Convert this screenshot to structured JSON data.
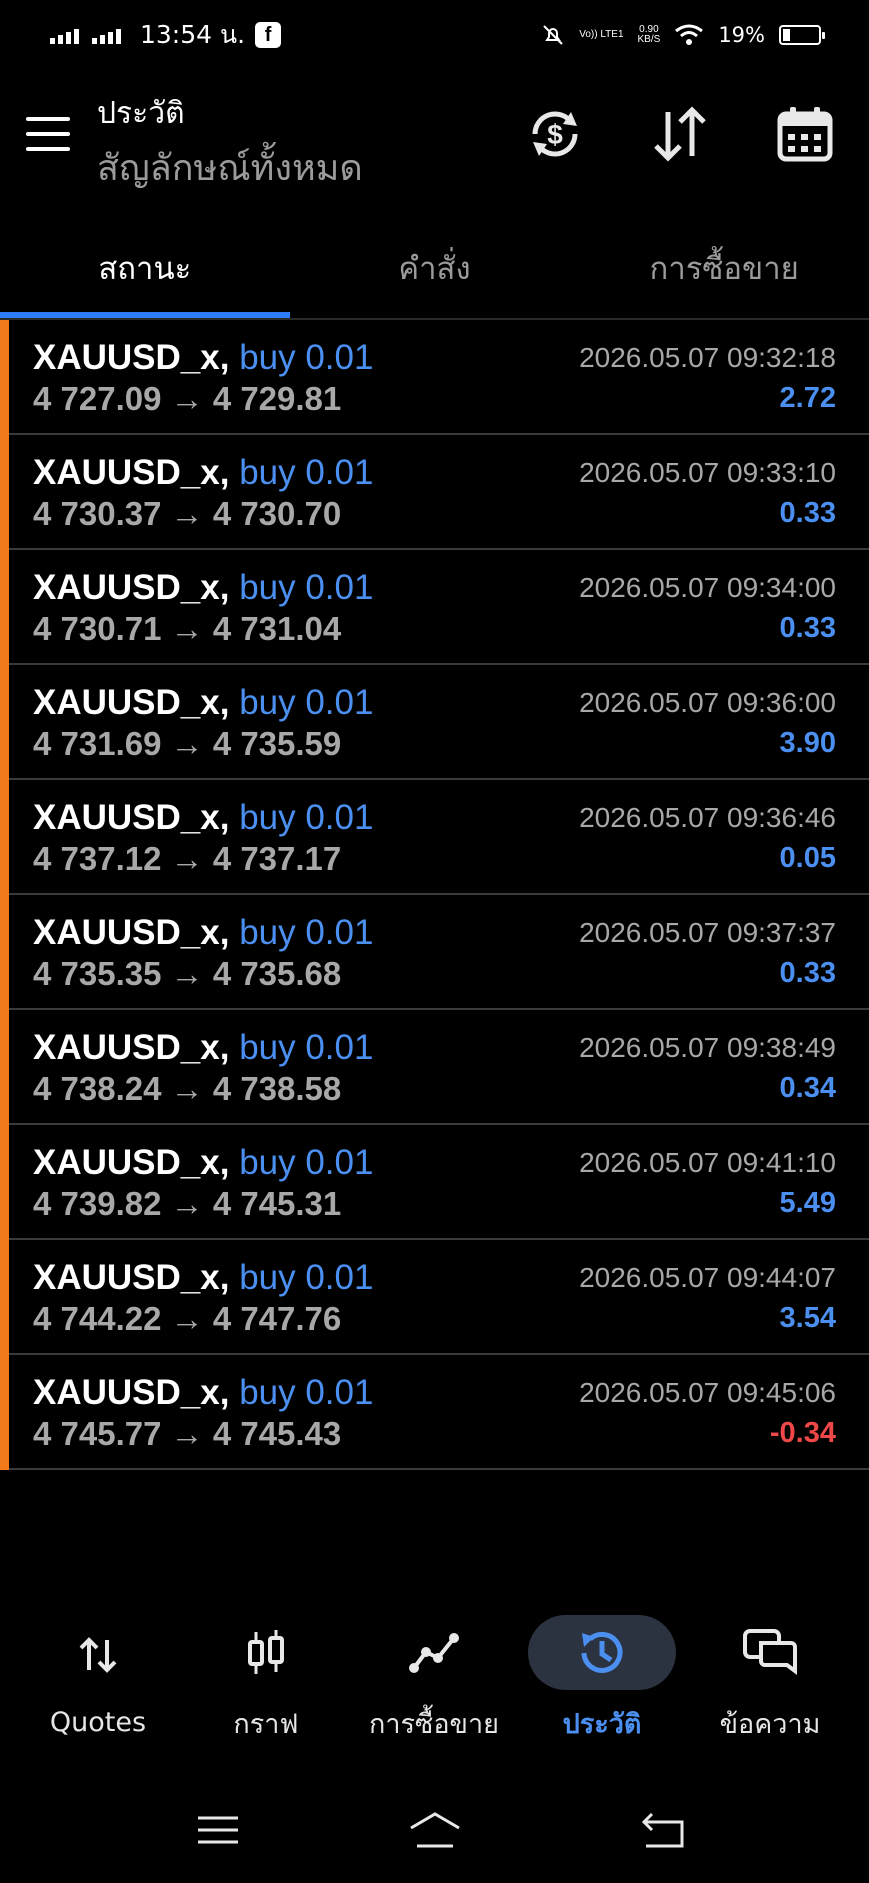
{
  "status_bar": {
    "time": "13:54 น.",
    "app_badge": "f",
    "volte": "Vo)) LTE1",
    "speed_value": "0.90",
    "speed_unit": "KB/S",
    "battery_percent": "19%",
    "battery_level": 0.19
  },
  "header": {
    "title": "ประวัติ",
    "subtitle": "สัญลักษณ์ทั้งหมด"
  },
  "tabs": [
    {
      "label": "สถานะ",
      "active": true
    },
    {
      "label": "คำสั่ง",
      "active": false
    },
    {
      "label": "การซื้อขาย",
      "active": false
    }
  ],
  "arrow": "→",
  "trades": [
    {
      "symbol": "XAUUSD_x,",
      "type": "buy 0.01",
      "open": "4 727.09",
      "close": "4 729.81",
      "time": "2026.05.07 09:32:18",
      "profit": "2.72"
    },
    {
      "symbol": "XAUUSD_x,",
      "type": "buy 0.01",
      "open": "4 730.37",
      "close": "4 730.70",
      "time": "2026.05.07 09:33:10",
      "profit": "0.33"
    },
    {
      "symbol": "XAUUSD_x,",
      "type": "buy 0.01",
      "open": "4 730.71",
      "close": "4 731.04",
      "time": "2026.05.07 09:34:00",
      "profit": "0.33"
    },
    {
      "symbol": "XAUUSD_x,",
      "type": "buy 0.01",
      "open": "4 731.69",
      "close": "4 735.59",
      "time": "2026.05.07 09:36:00",
      "profit": "3.90"
    },
    {
      "symbol": "XAUUSD_x,",
      "type": "buy 0.01",
      "open": "4 737.12",
      "close": "4 737.17",
      "time": "2026.05.07 09:36:46",
      "profit": "0.05"
    },
    {
      "symbol": "XAUUSD_x,",
      "type": "buy 0.01",
      "open": "4 735.35",
      "close": "4 735.68",
      "time": "2026.05.07 09:37:37",
      "profit": "0.33"
    },
    {
      "symbol": "XAUUSD_x,",
      "type": "buy 0.01",
      "open": "4 738.24",
      "close": "4 738.58",
      "time": "2026.05.07 09:38:49",
      "profit": "0.34"
    },
    {
      "symbol": "XAUUSD_x,",
      "type": "buy 0.01",
      "open": "4 739.82",
      "close": "4 745.31",
      "time": "2026.05.07 09:41:10",
      "profit": "5.49"
    },
    {
      "symbol": "XAUUSD_x,",
      "type": "buy 0.01",
      "open": "4 744.22",
      "close": "4 747.76",
      "time": "2026.05.07 09:44:07",
      "profit": "3.54"
    },
    {
      "symbol": "XAUUSD_x,",
      "type": "buy 0.01",
      "open": "4 745.77",
      "close": "4 745.43",
      "time": "2026.05.07 09:45:06",
      "profit": "-0.34"
    }
  ],
  "bottom_nav": [
    {
      "label": "Quotes",
      "icon": "quotes-arrows-icon",
      "active": false
    },
    {
      "label": "กราฟ",
      "icon": "candlestick-chart-icon",
      "active": false
    },
    {
      "label": "การซื้อขาย",
      "icon": "trade-line-icon",
      "active": false
    },
    {
      "label": "ประวัติ",
      "icon": "history-clock-icon",
      "active": true
    },
    {
      "label": "ข้อความ",
      "icon": "chat-bubbles-icon",
      "active": false
    }
  ],
  "colors": {
    "accent_blue": "#4b8ff0",
    "tab_underline": "#2f7df6",
    "loss_red": "#f04848",
    "row_marker_orange": "#f27a1a",
    "muted_gray": "#a8a8a8"
  }
}
